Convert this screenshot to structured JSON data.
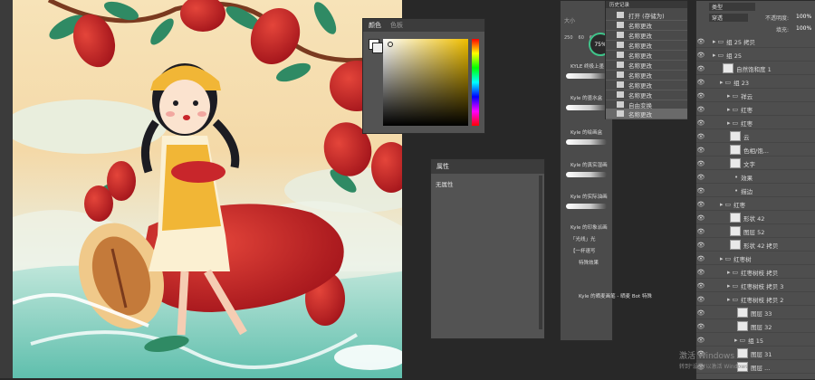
{
  "color_panel": {
    "tabs": [
      "颜色",
      "色板"
    ]
  },
  "properties_panel": {
    "tab": "属性",
    "content": "无属性"
  },
  "brushes_panel": {
    "top_label": "大小",
    "sizes": [
      "250",
      "60",
      "60"
    ],
    "zoom_percent": "75%",
    "items": [
      "KYLE 终极上墨",
      "Kyle 的墨水盒",
      "Kyle 的绘画盒",
      "Kyle 的真实湿画",
      "Kyle 的实际油画",
      "Kyle 的印象派画",
      "「光线」光",
      "【一杯速写",
      "特殊效果",
      "Kyle 的晒麦画笔 - 晒麦 Bot 特殊"
    ]
  },
  "history_panel": {
    "tab": "历史记录",
    "items": [
      "打开 (存储为)",
      "名称更改",
      "名称更改",
      "名称更改",
      "名称更改",
      "名称更改",
      "名称更改",
      "名称更改",
      "名称更改",
      "自由变换",
      "名称更改"
    ]
  },
  "layers_panel": {
    "filter_label": "类型",
    "blend_mode": "穿透",
    "opacity_label": "不透明度:",
    "opacity_value": "100%",
    "fill_label": "填充:",
    "fill_value": "100%",
    "layers": [
      {
        "name": "组 25 拷贝",
        "type": "group",
        "indent": 0
      },
      {
        "name": "组 25",
        "type": "group",
        "indent": 0
      },
      {
        "name": "自然饱和度 1",
        "type": "adjust",
        "indent": 1
      },
      {
        "name": "组 23",
        "type": "group",
        "indent": 1
      },
      {
        "name": "祥云",
        "type": "group",
        "indent": 2
      },
      {
        "name": "红枣",
        "type": "group",
        "indent": 2
      },
      {
        "name": "红枣",
        "type": "group",
        "indent": 2
      },
      {
        "name": "云",
        "type": "layer",
        "indent": 2
      },
      {
        "name": "色相/饱...",
        "type": "adjust",
        "indent": 2
      },
      {
        "name": "文字",
        "type": "layer",
        "indent": 2
      },
      {
        "name": "效果",
        "type": "fx",
        "indent": 3
      },
      {
        "name": "描边",
        "type": "fx",
        "indent": 3
      },
      {
        "name": "红枣",
        "type": "group",
        "indent": 1
      },
      {
        "name": "形状 42",
        "type": "layer",
        "indent": 2
      },
      {
        "name": "图层 52",
        "type": "layer",
        "indent": 2
      },
      {
        "name": "形状 42 拷贝",
        "type": "layer",
        "indent": 2
      },
      {
        "name": "红枣树",
        "type": "group",
        "indent": 1
      },
      {
        "name": "红枣树枝 拷贝",
        "type": "group",
        "indent": 2
      },
      {
        "name": "红枣树枝 拷贝 3",
        "type": "group",
        "indent": 2
      },
      {
        "name": "红枣树枝 拷贝 2",
        "type": "group",
        "indent": 2
      },
      {
        "name": "图层 33",
        "type": "layer",
        "indent": 3
      },
      {
        "name": "图层 32",
        "type": "layer",
        "indent": 3
      },
      {
        "name": "组 15",
        "type": "group",
        "indent": 3
      },
      {
        "name": "图层 31",
        "type": "layer",
        "indent": 3
      },
      {
        "name": "图层 ...",
        "type": "layer",
        "indent": 3
      }
    ]
  },
  "watermark": {
    "line1": "激活 Windows",
    "line2": "转到\"设置\"以激活 Windows"
  },
  "colors": {
    "accent_red": "#c8262b",
    "leaf_green": "#2f8a64",
    "apron_yellow": "#f1b636",
    "panel_bg": "#535353",
    "workspace_bg": "#282828"
  }
}
